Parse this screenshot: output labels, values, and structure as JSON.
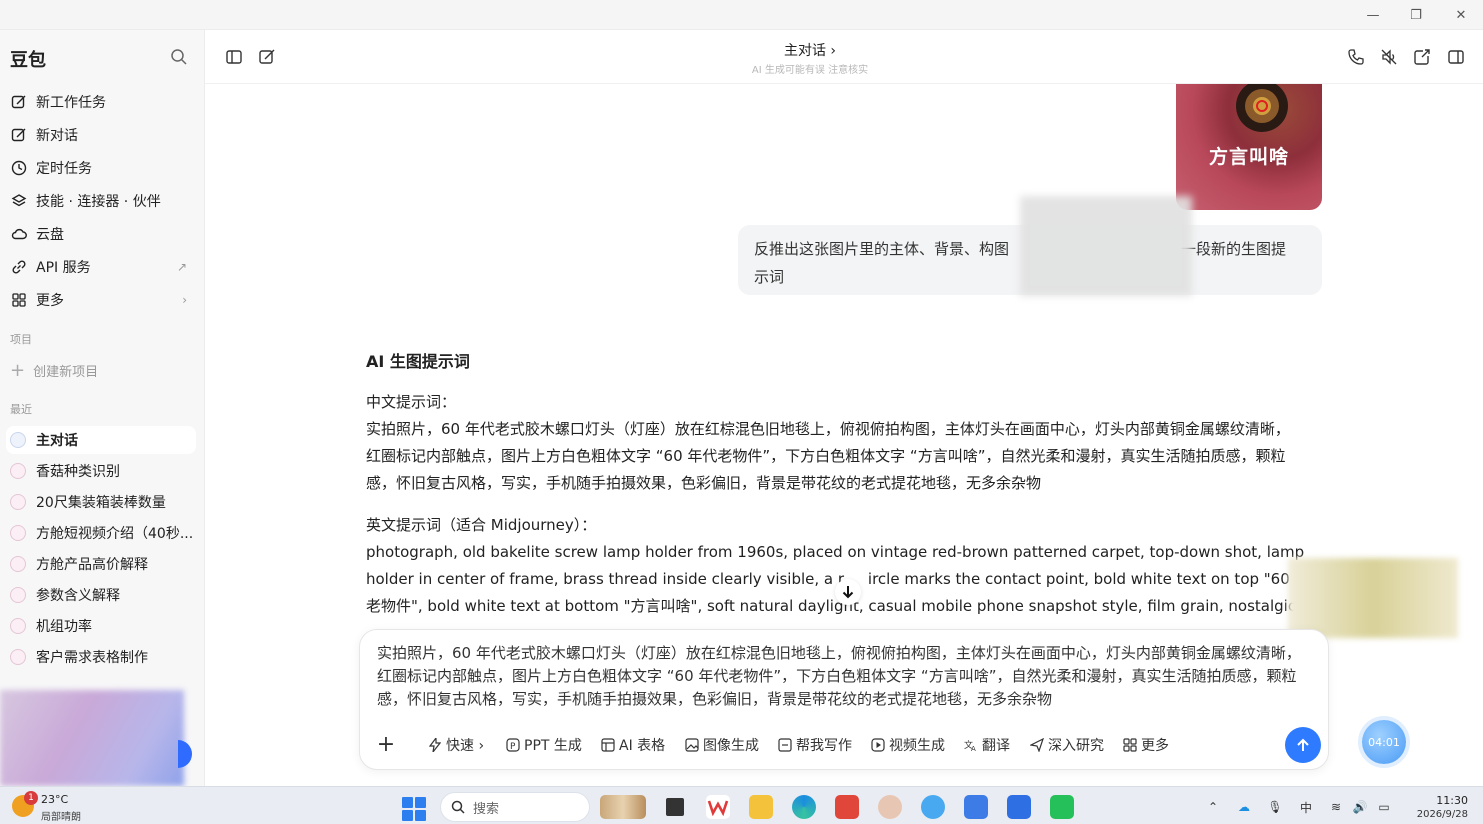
{
  "window": {
    "controls": [
      "—",
      "❐",
      "✕"
    ]
  },
  "sidebar": {
    "app_name": "豆包",
    "nav": [
      {
        "label": "新工作任务",
        "icon": "edit-icon"
      },
      {
        "label": "新对话",
        "icon": "compose-icon"
      },
      {
        "label": "定时任务",
        "icon": "clock-icon"
      },
      {
        "label": "技能 · 连接器 · 伙伴",
        "icon": "layers-icon"
      },
      {
        "label": "云盘",
        "icon": "cloud-icon"
      },
      {
        "label": "API 服务",
        "icon": "link-icon",
        "trail": "↗"
      },
      {
        "label": "更多",
        "icon": "grid-icon",
        "trail": "›"
      }
    ],
    "projects_label": "项目",
    "new_project_label": "创建新项目",
    "recent_label": "最近",
    "recent": [
      {
        "label": "主对话",
        "active": true
      },
      {
        "label": "香菇种类识别"
      },
      {
        "label": "20尺集装箱装棒数量"
      },
      {
        "label": "方舱短视频介绍（40秒..."
      },
      {
        "label": "方舱产品高价解释"
      },
      {
        "label": "参数含义解释"
      },
      {
        "label": "机组功率"
      },
      {
        "label": "客户需求表格制作"
      }
    ]
  },
  "header": {
    "title": "主对话 ›",
    "subtitle": "AI 生成可能有误 注意核实"
  },
  "chat": {
    "image_caption": "方言叫啥",
    "user_message_part1": "反推出这张图片里的主体、背景、构图",
    "user_message_part2": "一段新的生图提",
    "user_message_part3": "示词",
    "answer_title": "AI 生图提示词",
    "cn_label": "中文提示词：",
    "cn_lines": [
      "实拍照片，60 年代老式胶木螺口灯头（灯座）放在红棕混色旧地毯上，俯视俯拍构图，主体灯头在画面中心，灯头内部黄铜金属螺纹清晰，",
      "红圈标记内部触点，图片上方白色粗体文字 “60 年代老物件”，下方白色粗体文字 “方言叫啥”，自然光柔和漫射，真实生活随拍质感，颗粒",
      "感，怀旧复古风格，写实，手机随手拍摄效果，色彩偏旧，背景是带花纹的老式提花地毯，无多余杂物"
    ],
    "en_label": "英文提示词（适合 Midjourney）：",
    "en_lines": [
      "photograph, old bakelite screw lamp holder from 1960s, placed on vintage red-brown patterned carpet, top-down shot, lamp",
      "holder in center of frame, brass thread inside clearly visible, a r     ircle marks the contact point, bold white text on top \"60 年",
      "老物件\", bold white text at bottom \"方言叫啥\", soft natural daylight, casual mobile phone snapshot style, film grain, nostalgic"
    ]
  },
  "composer": {
    "text": "实拍照片，60 年代老式胶木螺口灯头（灯座）放在红棕混色旧地毯上，俯视俯拍构图，主体灯头在画面中心，灯头内部黄铜金属螺纹清晰，红圈标记内部触点，图片上方白色粗体文字 “60 年代老物件”，下方白色粗体文字 “方言叫啥”，自然光柔和漫射，真实生活随拍质感，颗粒感，怀旧复古风格，写实，手机随手拍摄效果，色彩偏旧，背景是带花纹的老式提花地毯，无多余杂物",
    "plus": "+",
    "tools": [
      {
        "label": "快速 ›",
        "icon": "bolt-icon"
      },
      {
        "label": "PPT 生成",
        "icon": "ppt-icon"
      },
      {
        "label": "AI 表格",
        "icon": "table-icon"
      },
      {
        "label": "图像生成",
        "icon": "image-icon"
      },
      {
        "label": "帮我写作",
        "icon": "write-icon"
      },
      {
        "label": "视频生成",
        "icon": "video-icon"
      },
      {
        "label": "翻译",
        "icon": "translate-icon"
      },
      {
        "label": "深入研究",
        "icon": "research-icon"
      },
      {
        "label": "更多",
        "icon": "grid-icon"
      }
    ]
  },
  "timer": "04:01",
  "taskbar": {
    "weather_badge": "1",
    "temperature": "23°C",
    "weather": "局部晴朗",
    "search_placeholder": "搜索",
    "ime": "中",
    "time": "11:30",
    "date": "2026/9/28"
  },
  "colors": {
    "accent": "#2f7bff",
    "sidebar_bg": "#f7f7f8",
    "bubble_bg": "#f3f4f6"
  }
}
